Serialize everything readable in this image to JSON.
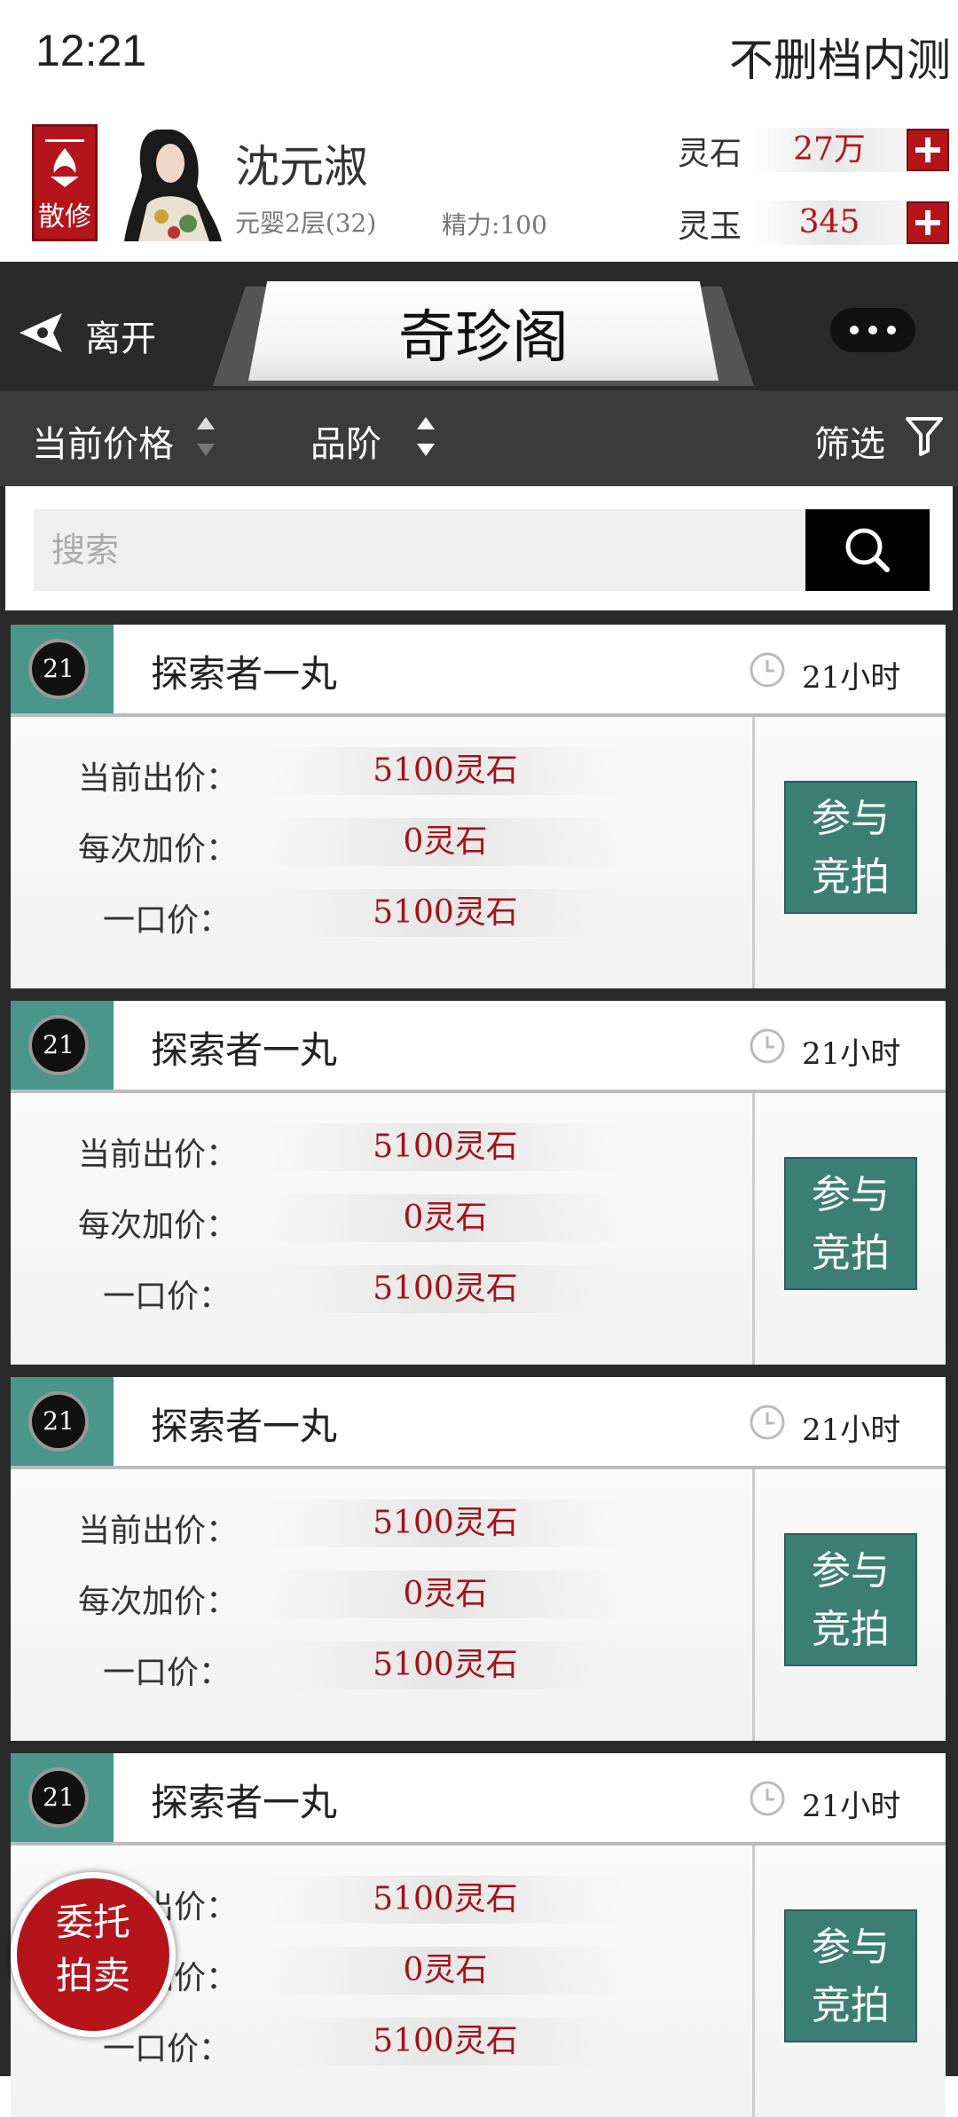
{
  "status": {
    "time": "12:21",
    "right_text": "不删档内测"
  },
  "player": {
    "sect": "散修",
    "name": "沈元淑",
    "realm": "元婴2层(32)",
    "energy": "精力:100",
    "currencies": [
      {
        "label": "灵石",
        "value": "27万"
      },
      {
        "label": "灵玉",
        "value": "345"
      }
    ]
  },
  "titlebar": {
    "back_label": "离开",
    "title": "奇珍阁"
  },
  "sortbar": {
    "price_label": "当前价格",
    "grade_label": "品阶",
    "filter_label": "筛选"
  },
  "search": {
    "placeholder": "搜索"
  },
  "listings": [
    {
      "level": "21",
      "name": "探索者一丸",
      "time_left": "21小时",
      "current_bid_label": "当前出价：",
      "current_bid": "5100灵石",
      "increment_label": "每次加价：",
      "increment": "0灵石",
      "buyout_label": "一口价：",
      "buyout": "5100灵石",
      "bid_button": [
        "参与",
        "竞拍"
      ]
    },
    {
      "level": "21",
      "name": "探索者一丸",
      "time_left": "21小时",
      "current_bid_label": "当前出价：",
      "current_bid": "5100灵石",
      "increment_label": "每次加价：",
      "increment": "0灵石",
      "buyout_label": "一口价：",
      "buyout": "5100灵石",
      "bid_button": [
        "参与",
        "竞拍"
      ]
    },
    {
      "level": "21",
      "name": "探索者一丸",
      "time_left": "21小时",
      "current_bid_label": "当前出价：",
      "current_bid": "5100灵石",
      "increment_label": "每次加价：",
      "increment": "0灵石",
      "buyout_label": "一口价：",
      "buyout": "5100灵石",
      "bid_button": [
        "参与",
        "竞拍"
      ]
    },
    {
      "level": "21",
      "name": "探索者一丸",
      "time_left": "21小时",
      "current_bid_label": "当前出价：",
      "current_bid": "5100灵石",
      "increment_label": "每次加价：",
      "increment": "0灵石",
      "buyout_label": "一口价：",
      "buyout": "5100灵石",
      "bid_button": [
        "参与",
        "竞拍"
      ]
    }
  ],
  "consign_button": [
    "委托",
    "拍卖"
  ],
  "colors": {
    "accent_red": "#b5141b",
    "teal": "#3b7f74",
    "dark_bar": "#2a2a2a"
  },
  "icons": [
    "sect-emblem-icon",
    "back-arrow-icon",
    "more-icon",
    "sort-arrows-icon",
    "filter-icon",
    "search-icon",
    "clock-icon",
    "plus-icon"
  ]
}
